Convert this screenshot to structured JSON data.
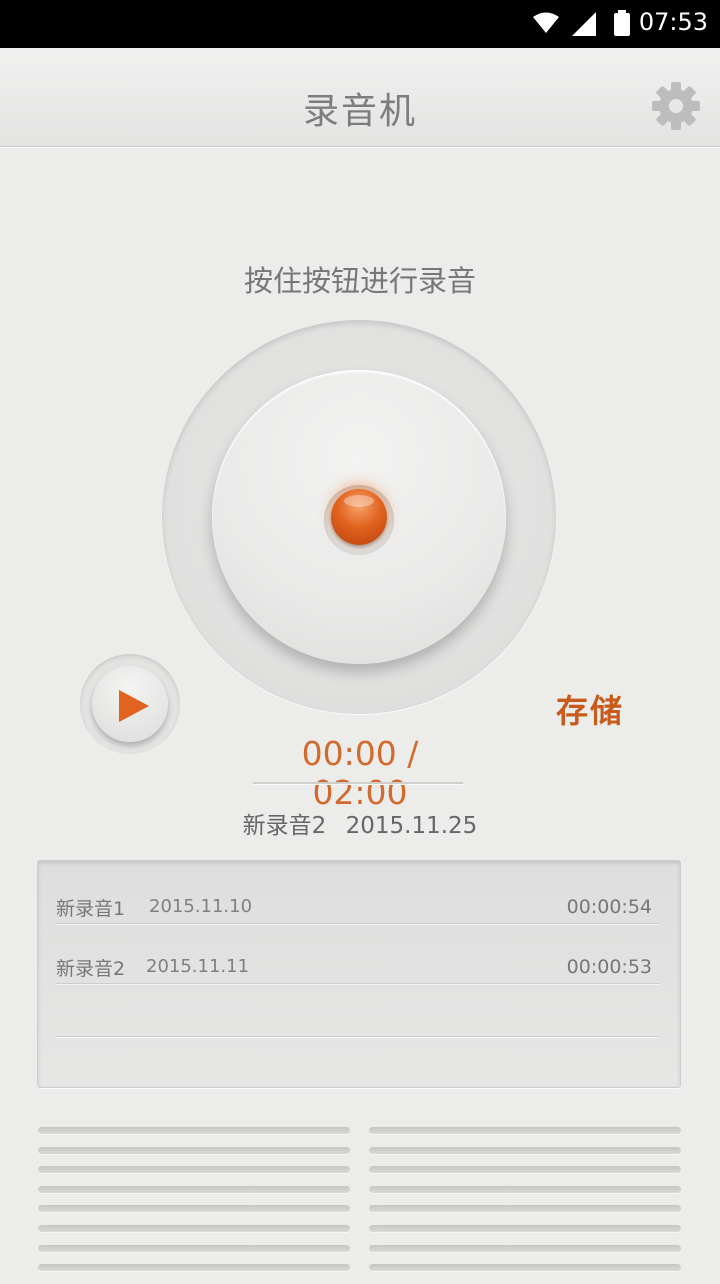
{
  "status_bar": {
    "time": "07:53"
  },
  "header": {
    "title": "录音机"
  },
  "prompt": "按住按钮进行录音",
  "save_label": "存储",
  "timer": "00:00 / 02:00",
  "current_recording": {
    "name": "新录音2",
    "date": "2015.11.25"
  },
  "recordings": [
    {
      "name": "新录音1",
      "date": "2015.11.10",
      "duration": "00:00:54"
    },
    {
      "name": "新录音2",
      "date": "2015.11.11",
      "duration": "00:00:53"
    }
  ],
  "colors": {
    "accent": "#d36a2d",
    "record": "#e2631f"
  },
  "icons": [
    "wifi-icon",
    "signal-icon",
    "battery-icon",
    "gear-icon",
    "record-icon",
    "play-icon"
  ]
}
